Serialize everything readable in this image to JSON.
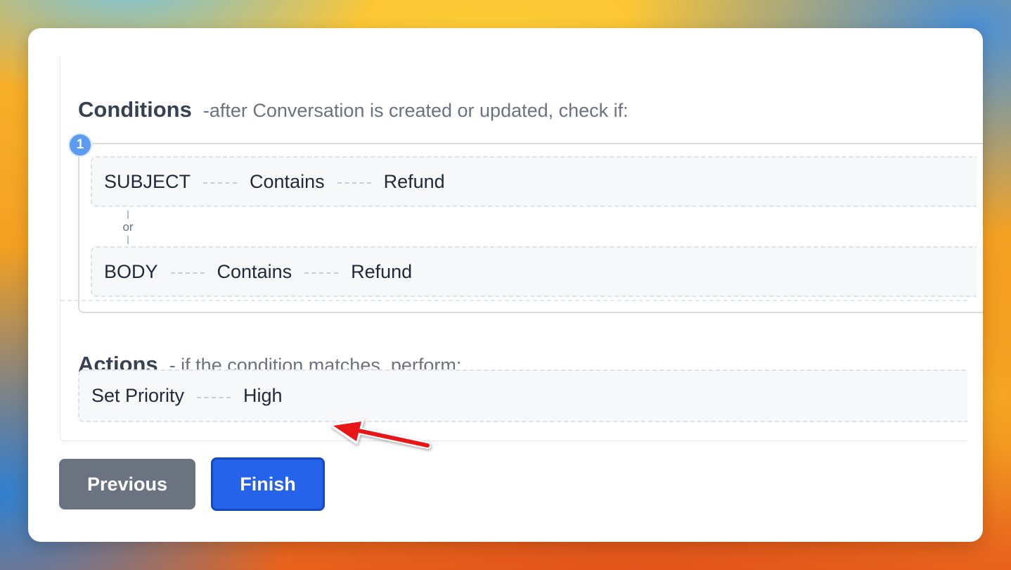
{
  "conditions": {
    "title": "Conditions",
    "subtitle": "-after Conversation is created or updated, check if:",
    "group_number": "1",
    "connector": "or",
    "rows": [
      {
        "field": "SUBJECT",
        "operator": "Contains",
        "value": "Refund"
      },
      {
        "field": "BODY",
        "operator": "Contains",
        "value": "Refund"
      }
    ]
  },
  "actions": {
    "title": "Actions",
    "subtitle": "- if the condition matches, perform:",
    "rows": [
      {
        "action": "Set Priority",
        "value": "High"
      }
    ]
  },
  "buttons": {
    "previous": "Previous",
    "finish": "Finish"
  },
  "colors": {
    "primary": "#2563eb",
    "secondary": "#6b7280",
    "badge": "#5b9cf2",
    "annotation_arrow": "#e81515"
  },
  "annotation": {
    "icon": "red-arrow-icon",
    "points_to": "actions.rows.0.value"
  }
}
